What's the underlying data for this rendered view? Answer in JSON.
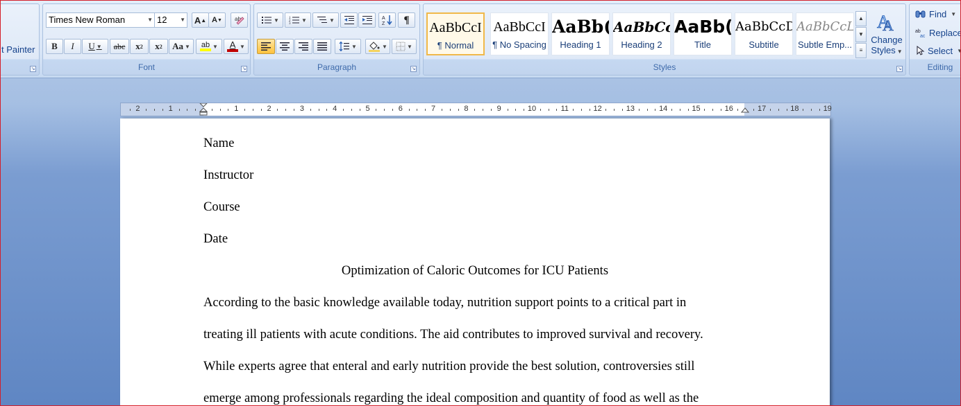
{
  "clipboard": {
    "format_painter_label": "t Painter"
  },
  "font": {
    "group_label": "Font",
    "font_name": "Times New Roman",
    "font_size": "12",
    "grow_label": "A",
    "shrink_label": "A",
    "bold_label": "B",
    "italic_label": "I",
    "underline_label": "U",
    "strike_label": "abc",
    "subscript_label": "x",
    "subscript_mark": "2",
    "superscript_label": "x",
    "superscript_mark": "2",
    "case_label": "Aa",
    "highlight_label": "ab",
    "font_color_label": "A",
    "highlight_color": "#ffff00",
    "font_color": "#c00000"
  },
  "paragraph": {
    "group_label": "Paragraph",
    "pilcrow_label": "¶"
  },
  "styles": {
    "group_label": "Styles",
    "tiles": [
      {
        "sample": "AaBbCcI",
        "name": "¶ Normal"
      },
      {
        "sample": "AaBbCcI",
        "name": "¶ No Spacing"
      },
      {
        "sample": "AaBb(",
        "name": "Heading 1"
      },
      {
        "sample": "AaBbCc",
        "name": "Heading 2"
      },
      {
        "sample": "AaBb(",
        "name": "Title"
      },
      {
        "sample": "AaBbCcD",
        "name": "Subtitle"
      },
      {
        "sample": "AaBbCcL",
        "name": "Subtle Emp..."
      }
    ],
    "change_styles_line1": "Change",
    "change_styles_line2": "Styles"
  },
  "editing": {
    "group_label": "Editing",
    "find_label": "Find",
    "replace_label": "Replace",
    "select_label": "Select"
  },
  "ruler": {
    "left_labels": [
      "2",
      "1"
    ],
    "right_labels": [
      "1",
      "2",
      "3",
      "4",
      "5",
      "6",
      "7",
      "8",
      "9",
      "10",
      "11",
      "12",
      "13",
      "14",
      "15",
      "16",
      "17",
      "18",
      "19"
    ]
  },
  "document": {
    "name_line": "Name",
    "instructor_line": "Instructor",
    "course_line": "Course",
    "date_line": "Date",
    "title": "Optimization of Caloric Outcomes for ICU Patients",
    "body_lines": [
      "According to the basic knowledge available today, nutrition support points to a critical part in",
      "treating ill patients with acute conditions. The aid contributes to improved survival and recovery.",
      "While experts agree that enteral and early nutrition provide the best solution, controversies still",
      "emerge among professionals regarding the ideal composition and quantity of food as well as the"
    ]
  }
}
